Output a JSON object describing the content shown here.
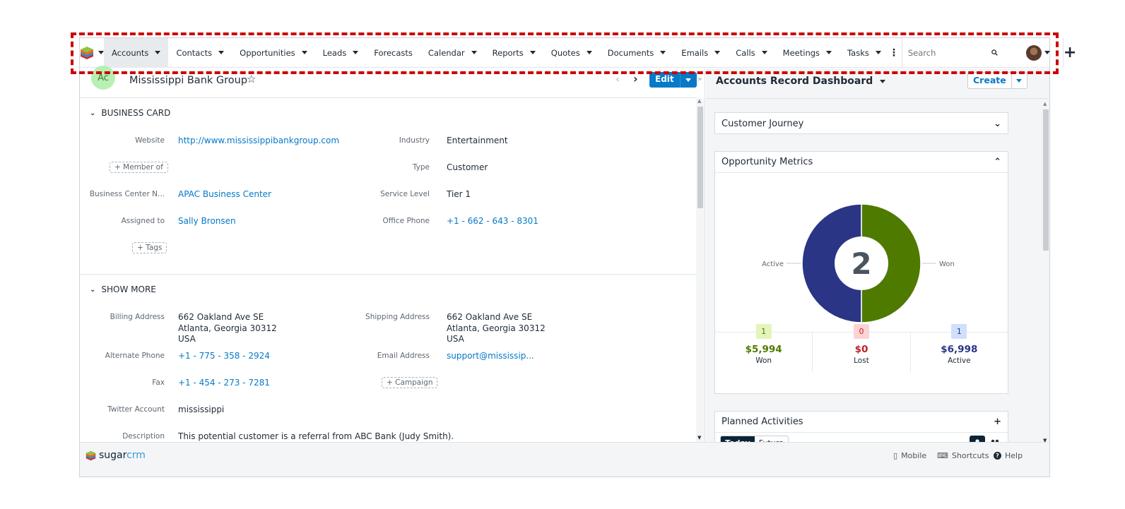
{
  "nav": {
    "items": [
      {
        "label": "Accounts",
        "active": true,
        "dropdown": true
      },
      {
        "label": "Contacts",
        "dropdown": true
      },
      {
        "label": "Opportunities",
        "dropdown": true
      },
      {
        "label": "Leads",
        "dropdown": true
      },
      {
        "label": "Forecasts",
        "dropdown": false
      },
      {
        "label": "Calendar",
        "dropdown": true
      },
      {
        "label": "Reports",
        "dropdown": true
      },
      {
        "label": "Quotes",
        "dropdown": true
      },
      {
        "label": "Documents",
        "dropdown": true
      },
      {
        "label": "Emails",
        "dropdown": true
      },
      {
        "label": "Calls",
        "dropdown": true
      },
      {
        "label": "Meetings",
        "dropdown": true
      },
      {
        "label": "Tasks",
        "dropdown": true
      }
    ],
    "search_placeholder": "Search",
    "plus": "+"
  },
  "record": {
    "module_badge": "Ac",
    "title": "Mississippi Bank Group",
    "star": "☆",
    "prev": "‹",
    "next": "›",
    "edit_label": "Edit"
  },
  "business_card": {
    "heading": "BUSINESS CARD",
    "website_label": "Website",
    "website": "http://www.mississippibankgroup.com",
    "member_of": "Member of",
    "business_center_label": "Business Center N...",
    "business_center": "APAC Business Center",
    "assigned_label": "Assigned to",
    "assigned": "Sally Bronsen",
    "tags": "Tags",
    "industry_label": "Industry",
    "industry": "Entertainment",
    "type_label": "Type",
    "type": "Customer",
    "service_label": "Service Level",
    "service": "Tier 1",
    "office_phone_label": "Office Phone",
    "office_phone": "+1 - 662 - 643 - 8301"
  },
  "show_more": {
    "heading": "SHOW MORE",
    "billing_label": "Billing Address",
    "billing_line1": "662 Oakland Ave SE",
    "billing_line2": "Atlanta, Georgia 30312",
    "billing_line3": "USA",
    "shipping_label": "Shipping Address",
    "shipping_line1": "662 Oakland Ave SE",
    "shipping_line2": "Atlanta, Georgia 30312",
    "shipping_line3": "USA",
    "alt_phone_label": "Alternate Phone",
    "alt_phone": "+1 - 775 - 358 - 2924",
    "email_label": "Email Address",
    "email": "support@mississip...",
    "fax_label": "Fax",
    "fax": "+1 - 454 - 273 - 7281",
    "campaign": "Campaign",
    "twitter_label": "Twitter Account",
    "twitter": "mississippi",
    "description_label": "Description",
    "description": "This potential customer is a referral from ABC Bank (Judy Smith)."
  },
  "dashboard": {
    "title": "Accounts Record Dashboard",
    "create_label": "Create",
    "customer_journey": "Customer Journey",
    "opportunity_metrics": "Opportunity Metrics",
    "planned_activities": "Planned Activities",
    "tab_today": "Today",
    "tab_future": "Future"
  },
  "chart_data": {
    "type": "pie",
    "center_label": "2",
    "slices": [
      {
        "label": "Won",
        "value": 1,
        "color": "#4f7a00"
      },
      {
        "label": "Active",
        "value": 1,
        "color": "#2a3586"
      }
    ]
  },
  "metrics": [
    {
      "count": "1",
      "amount": "$5,994",
      "label": "Won",
      "color": "#4f7a00",
      "badge_bg": "#e3f5b8"
    },
    {
      "count": "0",
      "amount": "$0",
      "label": "Lost",
      "color": "#c0212a",
      "badge_bg": "#fbd3d3"
    },
    {
      "count": "1",
      "amount": "$6,998",
      "label": "Active",
      "color": "#2a3586",
      "badge_bg": "#cfe0fb"
    }
  ],
  "footer": {
    "brand_sugar": "sugar",
    "brand_crm": "crm",
    "mobile": "Mobile",
    "shortcuts": "Shortcuts",
    "help": "Help"
  }
}
